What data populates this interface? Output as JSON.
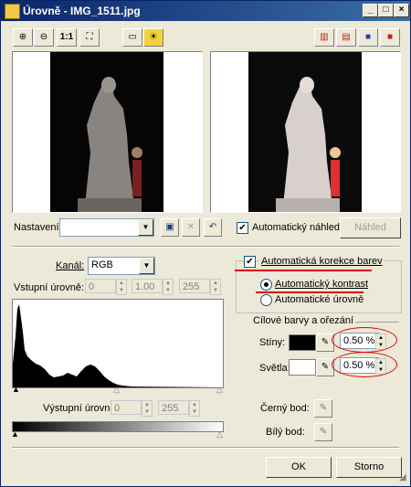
{
  "window": {
    "title": "Úrovně - IMG_1511.jpg",
    "controls": [
      "_",
      "□",
      "×"
    ]
  },
  "toolbar": {
    "zoom_actual_label": "1:1"
  },
  "settings": {
    "nastaveni_label": "Nastavení:",
    "nastaveni_value": "",
    "auto_preview_label": "Automatický náhled",
    "auto_preview_checked": true,
    "preview_button": "Náhled"
  },
  "levels": {
    "kanal_label": "Kanál:",
    "kanal_value": "RGB",
    "input_levels_label": "Vstupní úrovně:",
    "input_values": [
      "0",
      "1.00",
      "255"
    ],
    "output_levels_label": "Výstupní úrovně:",
    "output_values": [
      "0",
      "255"
    ]
  },
  "auto": {
    "auto_color_label": "Automatická korekce barev",
    "auto_color_checked": true,
    "auto_contrast_label": "Automatický kontrast",
    "auto_levels_label": "Automatické úrovně",
    "selected": "auto_contrast"
  },
  "targets": {
    "group_label": "Cílové barvy a ořezání",
    "shadows_label": "Stíny:",
    "shadows_color": "#000000",
    "shadows_value": "0.50 %",
    "highlights_label": "Světla:",
    "highlights_color": "#ffffff",
    "highlights_value": "0.50 %"
  },
  "points": {
    "black_label": "Černý bod:",
    "white_label": "Bílý bod:"
  },
  "footer": {
    "ok": "OK",
    "cancel": "Storno"
  },
  "annotation_color": "#e00000"
}
